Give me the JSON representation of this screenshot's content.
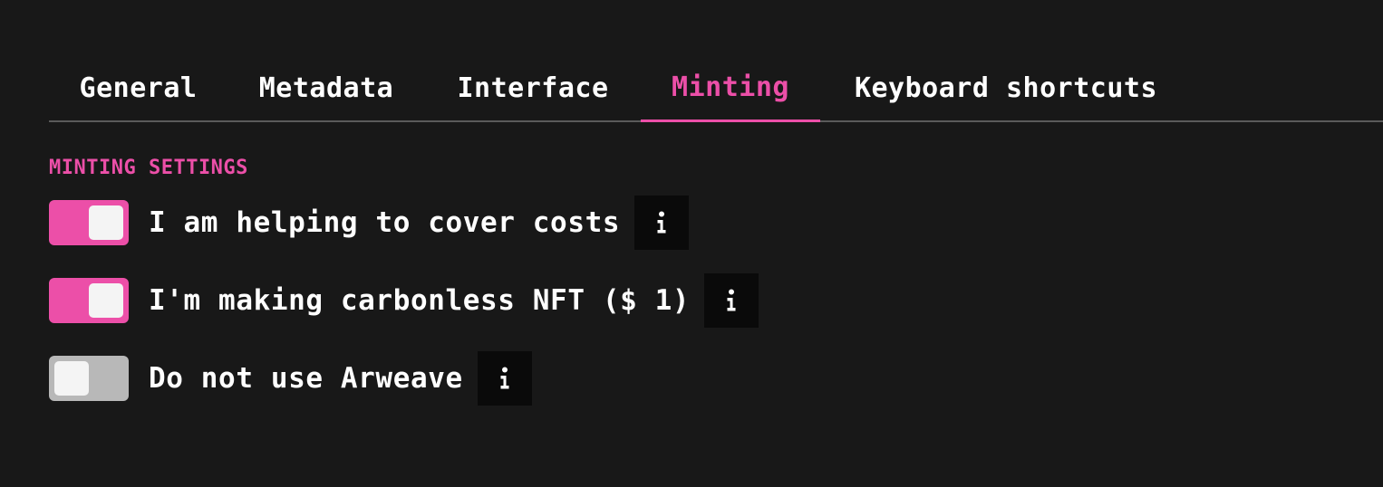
{
  "colors": {
    "background": "#181818",
    "accent": "#ec4fa8",
    "toggle_off": "#b8b8b8",
    "text": "#ffffff",
    "info_button": "#0a0a0a"
  },
  "tabs": [
    {
      "label": "General",
      "active": false
    },
    {
      "label": "Metadata",
      "active": false
    },
    {
      "label": "Interface",
      "active": false
    },
    {
      "label": "Minting",
      "active": true
    },
    {
      "label": "Keyboard shortcuts",
      "active": false
    }
  ],
  "section": {
    "title": "MINTING SETTINGS"
  },
  "settings": [
    {
      "label": "I am helping to cover costs",
      "enabled": true,
      "icon": "info-icon"
    },
    {
      "label": "I'm making carbonless NFT ($ 1)",
      "enabled": true,
      "icon": "info-icon"
    },
    {
      "label": "Do not use Arweave",
      "enabled": false,
      "icon": "info-icon"
    }
  ]
}
